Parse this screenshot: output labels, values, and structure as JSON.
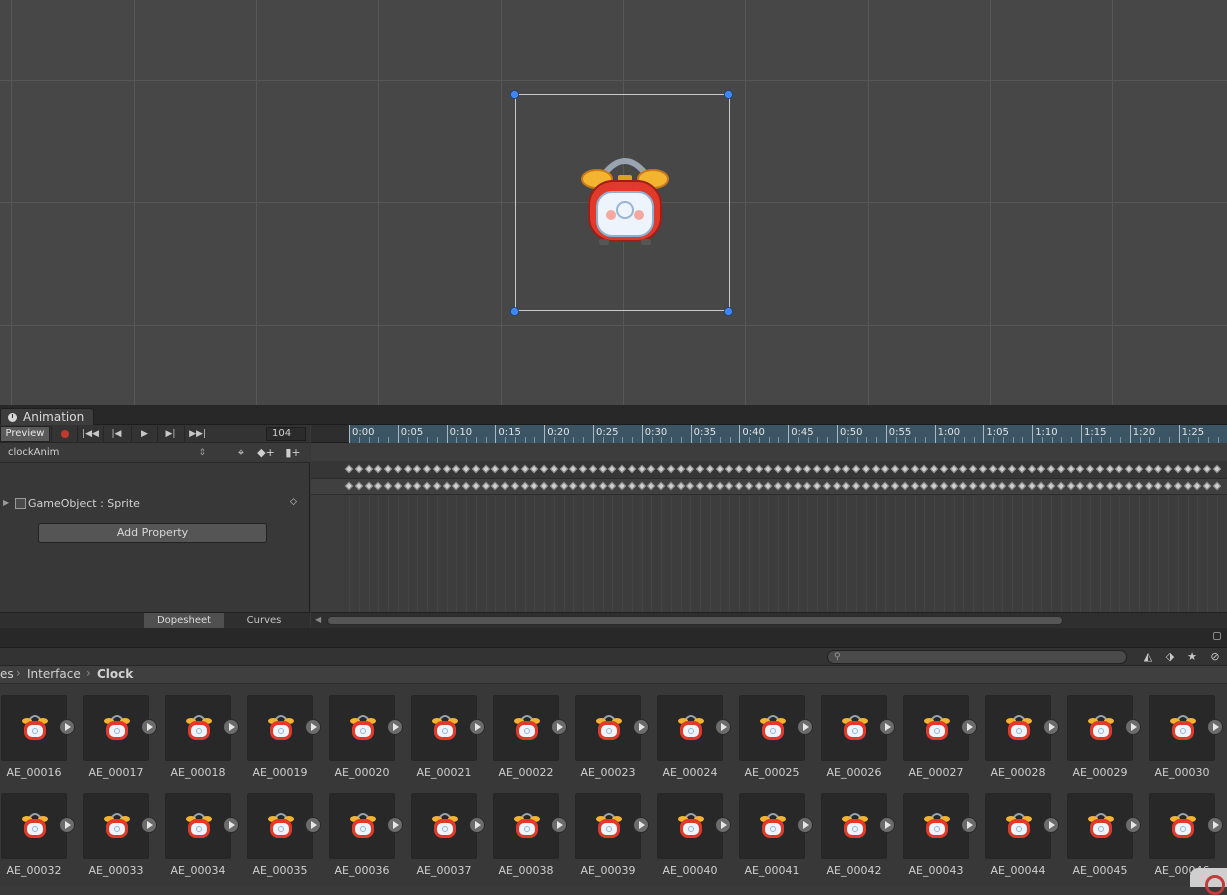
{
  "animation_window": {
    "tab_title": "Animation",
    "preview_label": "Preview",
    "frame_value": "104",
    "clip_name": "clockAnim",
    "property_label": "GameObject : Sprite",
    "add_property_label": "Add Property",
    "dopesheet_label": "Dopesheet",
    "curves_label": "Curves",
    "timeline_labels": [
      "0:00",
      "0:05",
      "0:10",
      "0:15",
      "0:20",
      "0:25",
      "0:30",
      "0:35",
      "0:40",
      "0:45",
      "0:50",
      "0:55",
      "1:00",
      "1:05",
      "1:10",
      "1:15",
      "1:20",
      "1:25"
    ]
  },
  "breadcrumb": {
    "items": [
      "es",
      "Interface",
      "Clock"
    ]
  },
  "assets": {
    "row1": [
      "AE_00016",
      "AE_00017",
      "AE_00018",
      "AE_00019",
      "AE_00020",
      "AE_00021",
      "AE_00022",
      "AE_00023",
      "AE_00024",
      "AE_00025",
      "AE_00026",
      "AE_00027",
      "AE_00028",
      "AE_00029",
      "AE_00030"
    ],
    "row2": [
      "AE_00032",
      "AE_00033",
      "AE_00034",
      "AE_00035",
      "AE_00036",
      "AE_00037",
      "AE_00038",
      "AE_00039",
      "AE_00040",
      "AE_00041",
      "AE_00042",
      "AE_00043",
      "AE_00044",
      "AE_00045",
      "AE_00046"
    ]
  },
  "colors": {
    "handle": "#3d86f0",
    "record": "#c23a2f",
    "clock_body": "#e23a2a",
    "clock_bell": "#f3b52f"
  }
}
